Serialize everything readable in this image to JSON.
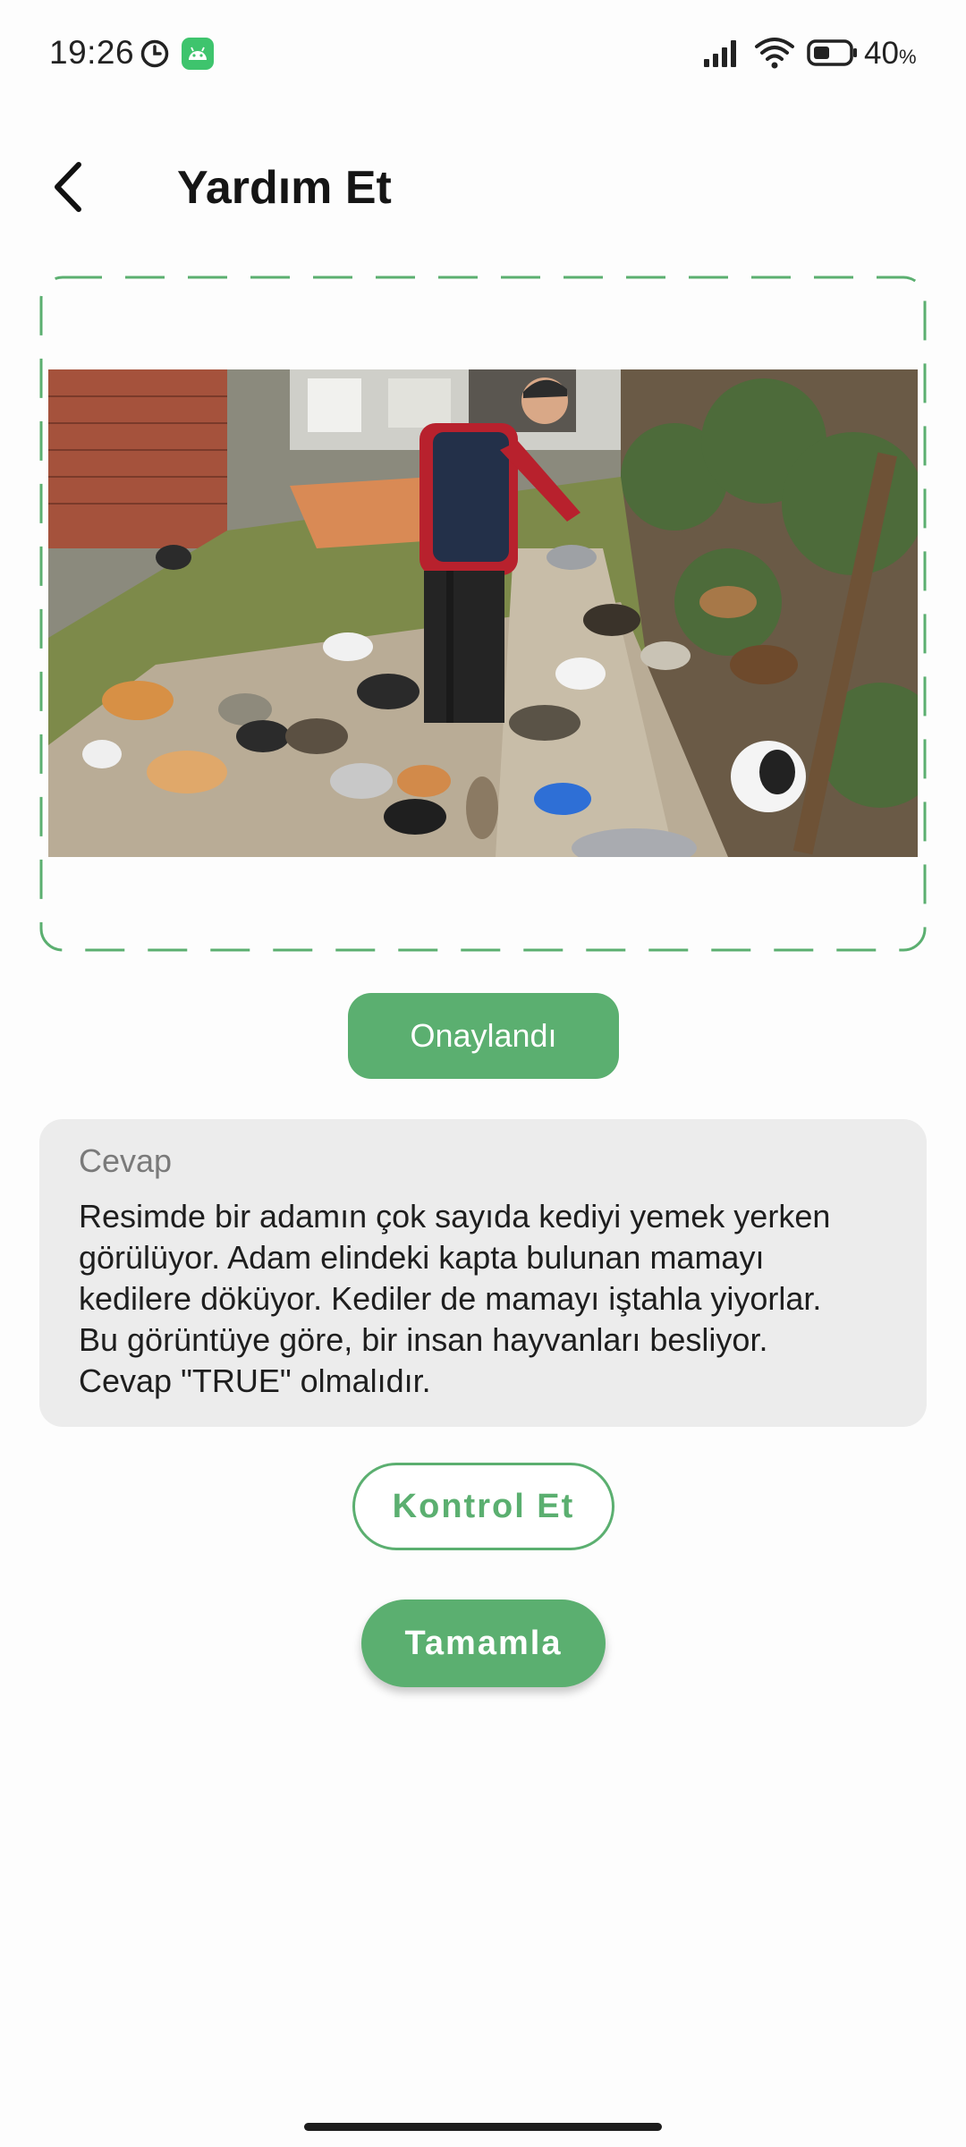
{
  "status_bar": {
    "time": "19:26",
    "battery_value": "40",
    "battery_unit": "%",
    "icons": [
      "clock-icon",
      "android-icon",
      "signal-icon",
      "wifi-icon",
      "battery-icon"
    ]
  },
  "header": {
    "title": "Yardım Et",
    "back_icon": "chevron-left-icon"
  },
  "image": {
    "description_icon": "photo-man-feeding-cats"
  },
  "status_badge": {
    "label": "Onaylandı",
    "color": "#5baf70"
  },
  "answer": {
    "label": "Cevap",
    "text_lines": [
      "Resimde bir adamın çok sayıda kediyi yemek yerken",
      "görülüyor. Adam elindeki kapta bulunan mamayı",
      "kedilere döküyor. Kediler de mamayı iştahla yiyorlar.",
      "Bu görüntüye göre, bir insan hayvanları besliyor.",
      "Cevap \"TRUE\" olmalıdır."
    ]
  },
  "buttons": {
    "check_label": "Kontrol Et",
    "complete_label": "Tamamla"
  },
  "colors": {
    "accent": "#5baf70",
    "card_background": "#ececec",
    "dashed_border": "#5baf70"
  }
}
